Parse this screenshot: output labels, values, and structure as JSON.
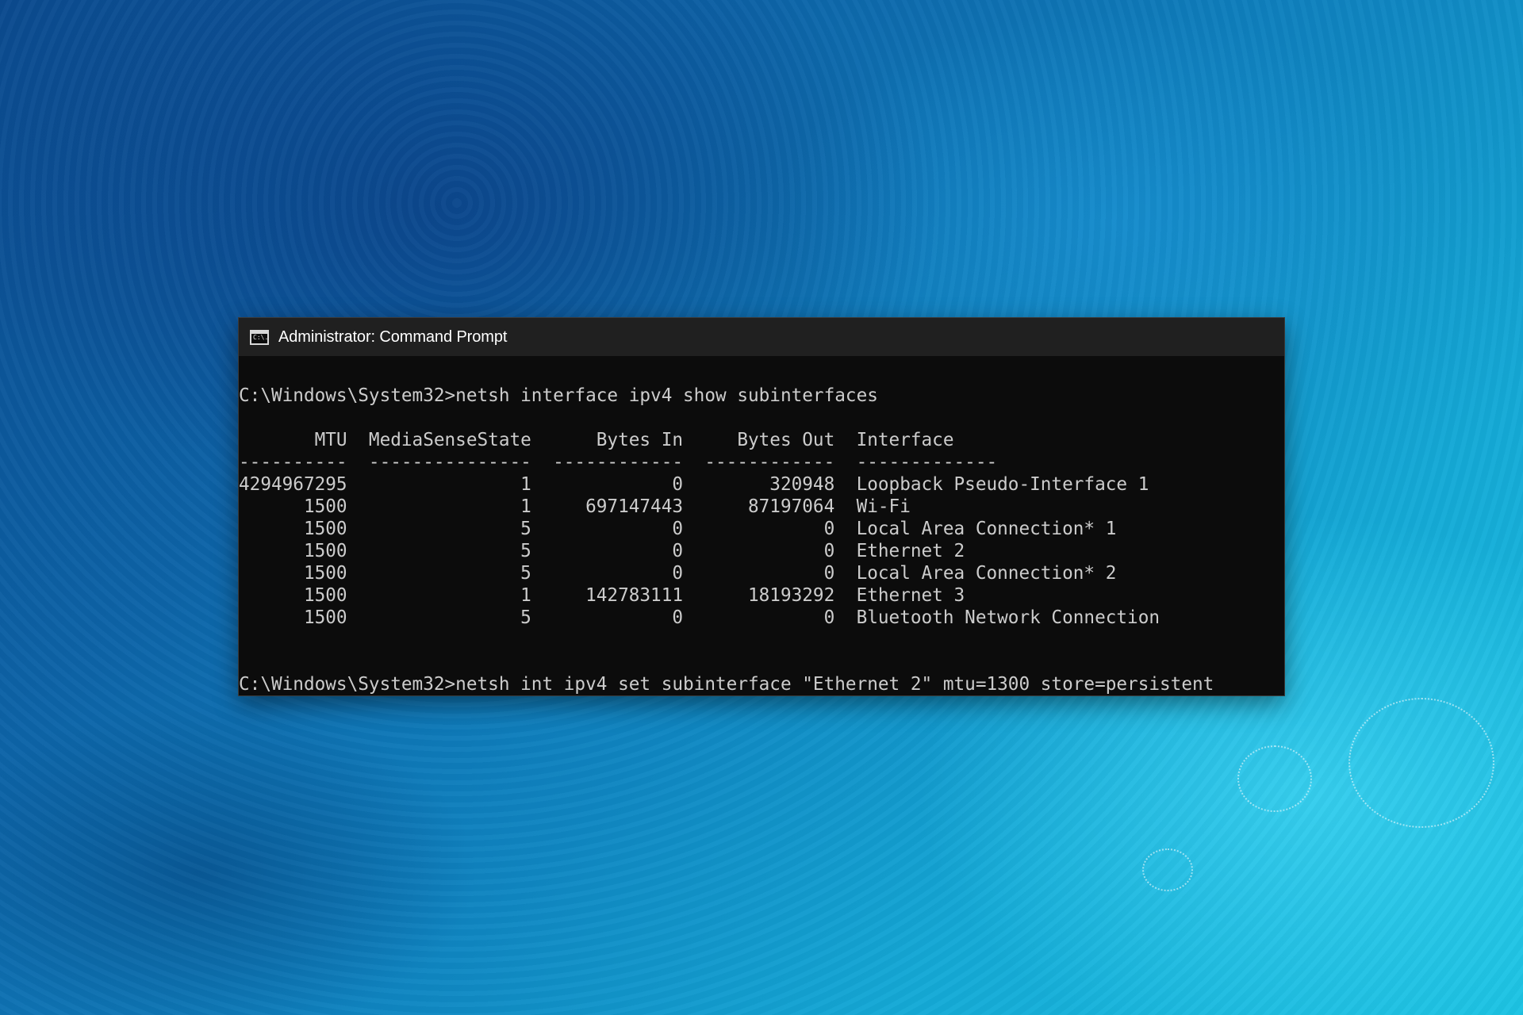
{
  "window": {
    "title": "Administrator: Command Prompt",
    "icon": "cmd-icon",
    "icon_text": "C:\\."
  },
  "console": {
    "command1": "C:\\Windows\\System32>netsh interface ipv4 show subinterfaces",
    "table": {
      "header": "       MTU  MediaSenseState      Bytes In     Bytes Out  Interface",
      "separator": "----------  ---------------  ------------  ------------  -------------",
      "rows": [
        "4294967295                1             0        320948  Loopback Pseudo-Interface 1",
        "      1500                1     697147443      87197064  Wi-Fi",
        "      1500                5             0             0  Local Area Connection* 1",
        "      1500                5             0             0  Ethernet 2",
        "      1500                5             0             0  Local Area Connection* 2",
        "      1500                1     142783111      18193292  Ethernet 3",
        "      1500                5             0             0  Bluetooth Network Connection"
      ]
    },
    "command2": "C:\\Windows\\System32>netsh int ipv4 set subinterface \"Ethernet 2\" mtu=1300 store=persistent"
  }
}
